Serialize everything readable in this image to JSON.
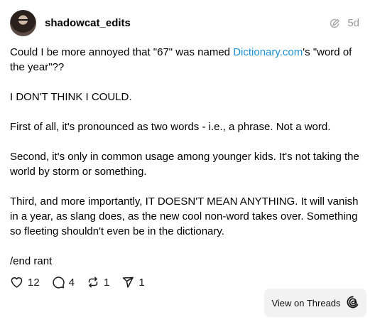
{
  "post": {
    "username": "shadowcat_edits",
    "time": "5d",
    "paragraph1_before": "Could I be more annoyed that \"67\" was named ",
    "link_text": "Dictionary.com",
    "paragraph1_after": "'s \"word of the year\"??",
    "paragraph2": "I DON'T THINK I COULD.",
    "paragraph3": "First of all, it's pronounced as two words - i.e., a phrase. Not a word.",
    "paragraph4": "Second, it's only in common usage among younger kids. It's not taking the world by storm or something.",
    "paragraph5": "Third, and more importantly, IT DOESN'T MEAN ANYTHING. It will vanish in a year, as slang does, as the new cool non-word takes over. Something so fleeting shouldn't even be in the dictionary.",
    "paragraph6": "/end rant"
  },
  "stats": {
    "likes": "12",
    "replies": "4",
    "reposts": "1",
    "shares": "1"
  },
  "cta": {
    "view_on_threads": "View on Threads"
  },
  "colors": {
    "link": "#1d8fd1",
    "muted": "#999999",
    "button_bg": "#f2f2f2"
  },
  "icons": [
    "avatar",
    "edited-icon",
    "heart-icon",
    "reply-icon",
    "repost-icon",
    "share-icon",
    "threads-logo-icon"
  ]
}
